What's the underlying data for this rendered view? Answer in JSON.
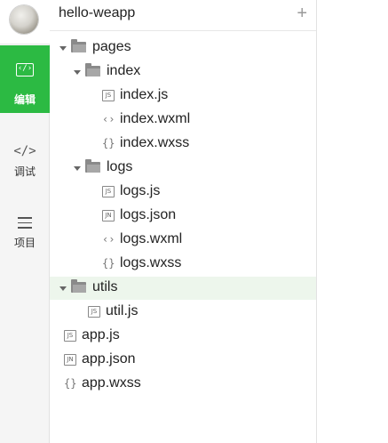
{
  "sidebar": {
    "items": [
      {
        "label": "编辑",
        "icon": "code-box-icon"
      },
      {
        "label": "调试",
        "icon": "code-brackets-icon"
      },
      {
        "label": "项目",
        "icon": "list-icon"
      }
    ],
    "accent": "#2cba43"
  },
  "explorer": {
    "title": "hello-weapp",
    "add_glyph": "+",
    "tree": [
      {
        "name": "pages",
        "type": "folder",
        "expanded": true
      },
      {
        "name": "index",
        "type": "folder",
        "expanded": true
      },
      {
        "name": "index.js",
        "type": "js",
        "badge": "JS"
      },
      {
        "name": "index.wxml",
        "type": "wxml",
        "glyph": "‹›"
      },
      {
        "name": "index.wxss",
        "type": "wxss",
        "glyph": "{}"
      },
      {
        "name": "logs",
        "type": "folder",
        "expanded": true
      },
      {
        "name": "logs.js",
        "type": "js",
        "badge": "JS"
      },
      {
        "name": "logs.json",
        "type": "json",
        "badge": "JN"
      },
      {
        "name": "logs.wxml",
        "type": "wxml",
        "glyph": "‹›"
      },
      {
        "name": "logs.wxss",
        "type": "wxss",
        "glyph": "{}"
      },
      {
        "name": "utils",
        "type": "folder",
        "expanded": true,
        "selected": true
      },
      {
        "name": "util.js",
        "type": "js",
        "badge": "JS"
      },
      {
        "name": "app.js",
        "type": "js",
        "badge": "JS"
      },
      {
        "name": "app.json",
        "type": "json",
        "badge": "JN"
      },
      {
        "name": "app.wxss",
        "type": "wxss",
        "glyph": "{}"
      }
    ]
  }
}
